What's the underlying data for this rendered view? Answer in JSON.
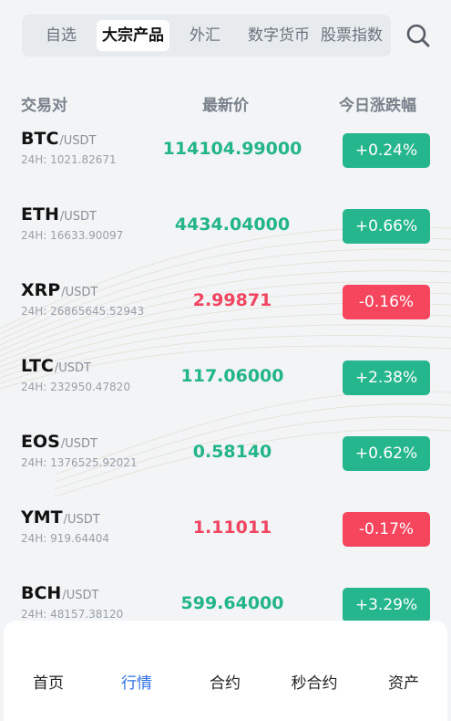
{
  "tabs": [
    {
      "label": "自选",
      "active": false
    },
    {
      "label": "大宗产品",
      "active": true
    },
    {
      "label": "外汇",
      "active": false
    },
    {
      "label": "数字货币",
      "active": false
    },
    {
      "label": "股票指数",
      "active": false
    }
  ],
  "table": {
    "headers": [
      "交易对",
      "最新价",
      "今日涨跌幅"
    ],
    "rows": [
      {
        "symbol": "BTC",
        "quote": "/USDT",
        "volume": "24H: 1021.82671",
        "price": "114104.99000",
        "change": "+0.24%",
        "direction": "up"
      },
      {
        "symbol": "ETH",
        "quote": "/USDT",
        "volume": "24H: 16633.90097",
        "price": "4434.04000",
        "change": "+0.66%",
        "direction": "up"
      },
      {
        "symbol": "XRP",
        "quote": "/USDT",
        "volume": "24H: 26865645.52943",
        "price": "2.99871",
        "change": "-0.16%",
        "direction": "down"
      },
      {
        "symbol": "LTC",
        "quote": "/USDT",
        "volume": "24H: 232950.47820",
        "price": "117.06000",
        "change": "+2.38%",
        "direction": "up"
      },
      {
        "symbol": "EOS",
        "quote": "/USDT",
        "volume": "24H: 1376525.92021",
        "price": "0.58140",
        "change": "+0.62%",
        "direction": "up"
      },
      {
        "symbol": "YMT",
        "quote": "/USDT",
        "volume": "24H: 919.64404",
        "price": "1.11011",
        "change": "-0.17%",
        "direction": "down"
      },
      {
        "symbol": "BCH",
        "quote": "/USDT",
        "volume": "24H: 48157.38120",
        "price": "599.64000",
        "change": "+3.29%",
        "direction": "up"
      }
    ]
  },
  "bottom_nav": [
    {
      "label": "首页",
      "active": false
    },
    {
      "label": "行情",
      "active": true
    },
    {
      "label": "合约",
      "active": false
    },
    {
      "label": "秒合约",
      "active": false
    },
    {
      "label": "资产",
      "active": false
    }
  ],
  "colors": {
    "up": "#26b68d",
    "down": "#f5465e",
    "accent": "#2e6fe6"
  },
  "icons": {
    "search": "search-icon"
  }
}
